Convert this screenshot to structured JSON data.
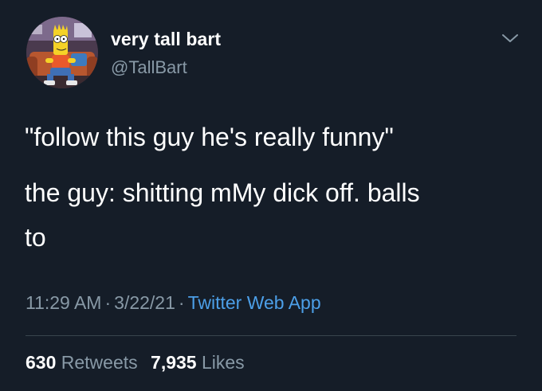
{
  "author": {
    "display_name": "very tall bart",
    "handle": "@TallBart"
  },
  "tweet": {
    "lines": [
      "\"follow this guy he's really funny\"",
      "the guy:  shitting mMy dick off. balls",
      "to"
    ],
    "time": "11:29 AM",
    "date": "3/22/21",
    "separator": "·",
    "source": "Twitter Web App"
  },
  "stats": {
    "retweets_count": "630",
    "retweets_label": "Retweets",
    "likes_count": "7,935",
    "likes_label": "Likes"
  },
  "icons": {
    "avatar": "bart-simpson-avatar",
    "menu": "chevron-down-icon"
  },
  "colors": {
    "background": "#151d28",
    "secondary_text": "#8899a6",
    "link": "#4c9fe8",
    "divider": "#38444d"
  }
}
